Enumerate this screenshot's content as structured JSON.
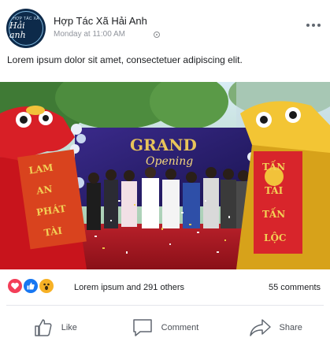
{
  "post": {
    "page_name": "Hợp Tác Xã Hải Anh",
    "timestamp": "Monday at 11:00 AM",
    "privacy_icon": "globe-icon",
    "text": "Lorem ipsum dolor sit amet, consectetuer adipiscing elit."
  },
  "avatar": {
    "logo_top": "HỢP TÁC XÃ",
    "logo_main": "Hải anh"
  },
  "photo": {
    "banner_line1": "GRAND",
    "banner_line2": "Opening",
    "left_scroll": [
      "LAM",
      "AN",
      "PHÁT",
      "TÀI"
    ],
    "right_scroll": [
      "TẤN",
      "TÀI",
      "TẤN",
      "LỘC"
    ]
  },
  "reactions": {
    "icons": [
      "love-icon",
      "like-icon",
      "wow-icon"
    ],
    "summary": "Lorem ipsum and  291 others",
    "comments": "55 comments"
  },
  "actions": {
    "like": "Like",
    "comment": "Comment",
    "share": "Share"
  },
  "colors": {
    "love": "#f33e58",
    "like": "#1877f2",
    "wow": "#f7b125",
    "text": "#1c1e21",
    "meta": "#90949c"
  }
}
